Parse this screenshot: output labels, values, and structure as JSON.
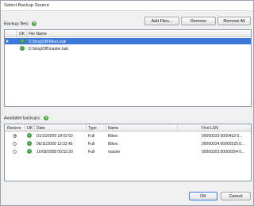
{
  "window": {
    "title": "Select Backup Source"
  },
  "backup_files": {
    "label": "Backup files:",
    "buttons": {
      "add": "Add Files...",
      "remove": "Remove",
      "remove_all": "Remove All"
    },
    "columns": {
      "ok": "OK",
      "file_name": "File Name"
    },
    "rows": [
      {
        "file_name": "D:\\blog\\DB\\Bikes.bak",
        "ok": true,
        "selected": true
      },
      {
        "file_name": "D:\\blog\\DB\\master.bak",
        "ok": true,
        "selected": false
      }
    ]
  },
  "available_backups": {
    "label": "Available backups:",
    "columns": {
      "restore": "Restore",
      "ok": "OK",
      "date": "Date",
      "type": "Type",
      "name": "Name",
      "first_lsn": "First LSN"
    },
    "rows": [
      {
        "restore": true,
        "ok": true,
        "date": "01/10/2009 18:52:02",
        "type": "Full",
        "name": "Bikes",
        "first_lsn": "00000033:0000432:0..."
      },
      {
        "restore": false,
        "ok": true,
        "date": "06/11/2009 12:32:45",
        "type": "Full",
        "name": "Bikes",
        "first_lsn": "00000034:00000225:0..."
      },
      {
        "restore": false,
        "ok": true,
        "date": "16/09/2008 00:52:20",
        "type": "Full",
        "name": "master",
        "first_lsn": "00000203:00000264:0..."
      }
    ]
  },
  "footer": {
    "ok": "OK",
    "cancel": "Cancel"
  },
  "icons": {
    "help": "help-icon",
    "ok_check": "check-circle-icon"
  }
}
